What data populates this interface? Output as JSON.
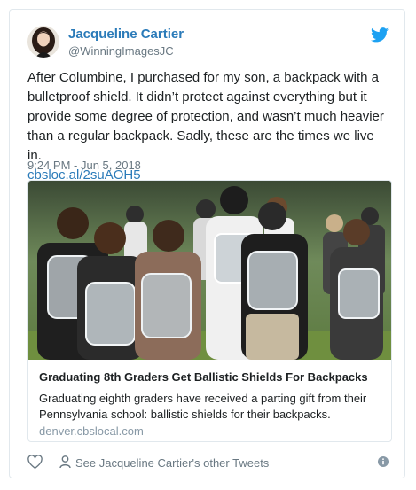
{
  "tweet": {
    "author_name": "Jacqueline Cartier",
    "author_handle": "@WinningImagesJC",
    "text": "After Columbine, I purchased for my son, a backpack with a bulletproof shield. It didn’t protect against everything but it provide some degree of protection, and wasn’t much heavier than a regular backpack. Sadly, these are the times we live in.",
    "link": "cbsloc.al/2suAOH5",
    "timestamp": "9:24 PM - Jun 5, 2018",
    "card": {
      "title": "Graduating 8th Graders Get Ballistic Shields For Backpacks",
      "description": "Graduating eighth graders have received a parting gift from their Pennsylvania school: ballistic shields for their backpacks.",
      "domain": "denver.cbslocal.com"
    },
    "footer": {
      "see_more": "See Jacqueline Cartier's other Tweets"
    }
  },
  "colors": {
    "link_blue": "#2b7bb9",
    "twitter_blue": "#1da1f2",
    "secondary_text": "#697882",
    "border": "#e1e8ed"
  },
  "icons": [
    "twitter-bird-icon",
    "heart-icon",
    "person-icon",
    "info-icon"
  ]
}
